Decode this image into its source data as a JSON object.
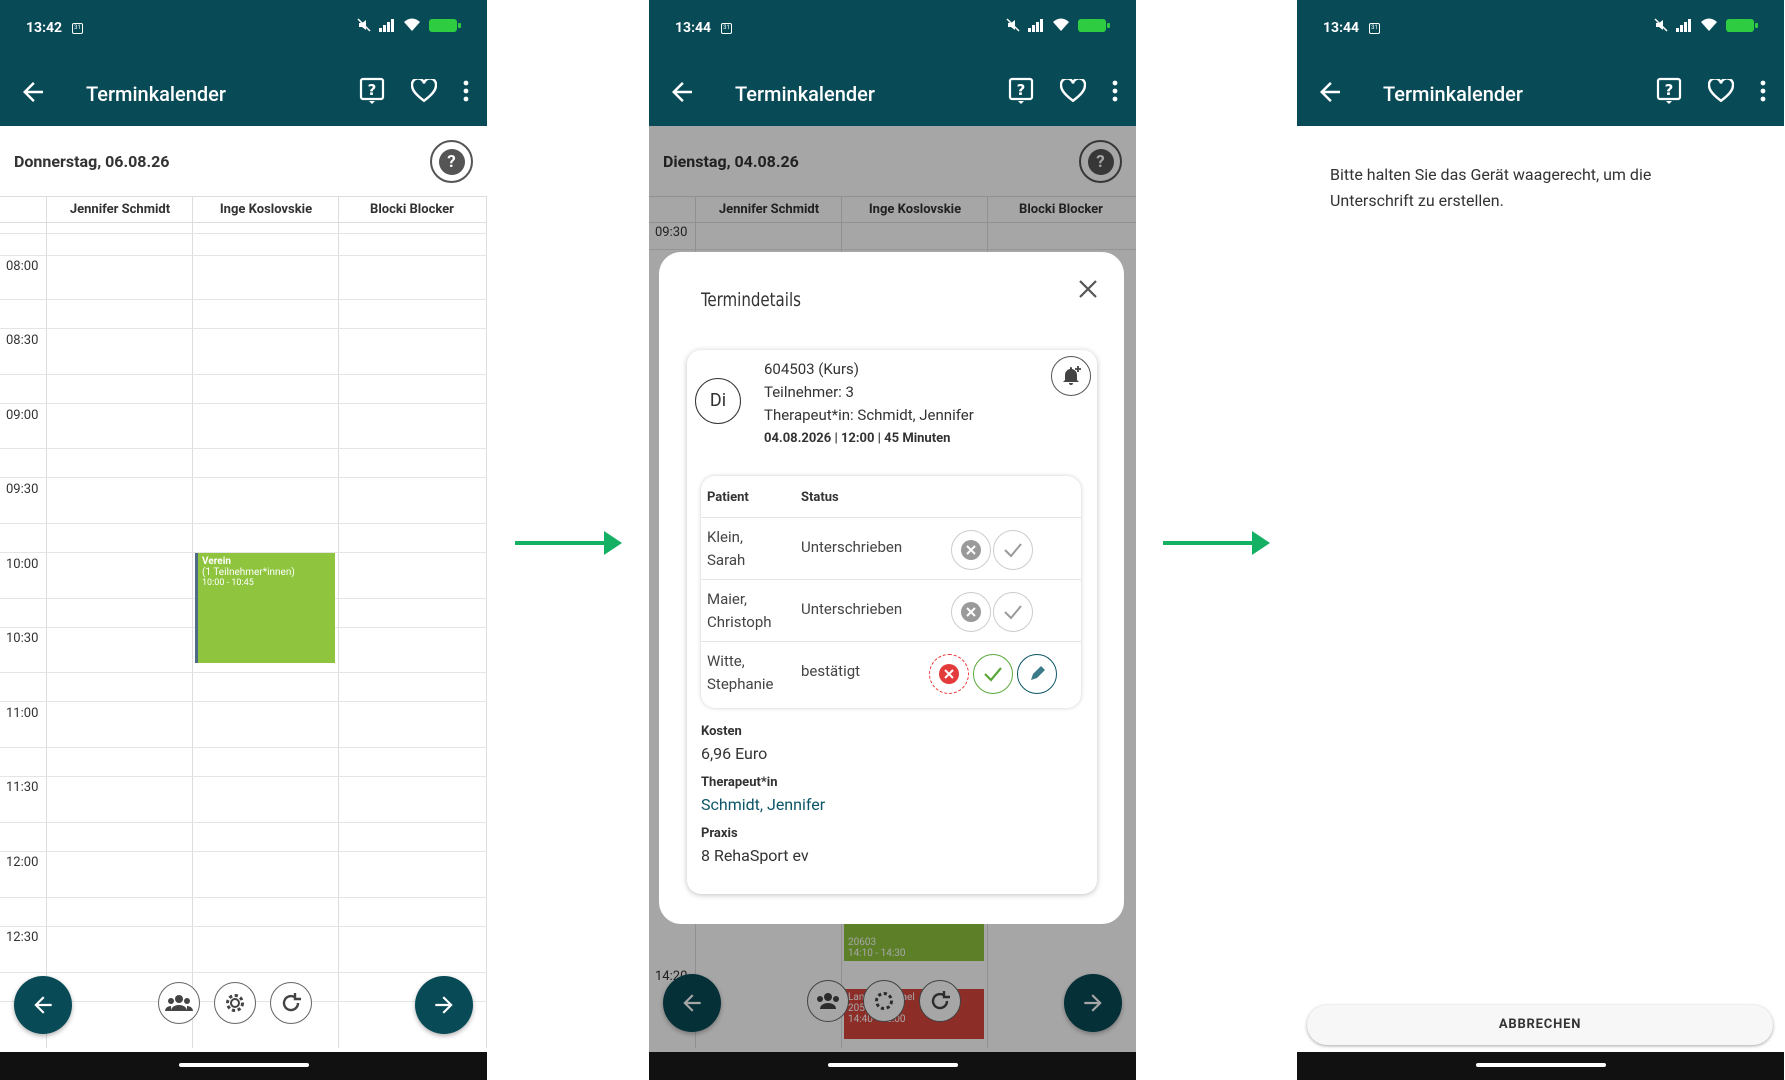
{
  "screen1": {
    "status_time": "13:42",
    "title": "Terminkalender",
    "date": "Donnerstag, 06.08.26",
    "columns": [
      "Jennifer Schmidt",
      "Inge Koslovskie",
      "Blocki Blocker"
    ],
    "times": [
      "08:00",
      "08:30",
      "09:00",
      "09:30",
      "10:00",
      "10:30",
      "11:00",
      "11:30",
      "12:00",
      "12:30"
    ],
    "event": {
      "title": "Verein",
      "subtitle": "(1 Teilnehmer*innen)",
      "time": "10:00 - 10:45",
      "color": "#8ec43e"
    }
  },
  "screen2": {
    "status_time": "13:44",
    "title": "Terminkalender",
    "date": "Dienstag, 04.08.26",
    "columns": [
      "Jennifer Schmidt",
      "Inge Koslovskie",
      "Blocki Blocker"
    ],
    "first_time": "09:30",
    "modal": {
      "title": "Termindetails",
      "day_badge": "Di",
      "line1": "604503 (Kurs)",
      "line2": "Teilnehmer: 3",
      "line3": "Therapeut*in: Schmidt, Jennifer",
      "line4": "04.08.2026 | 12:00 | 45 Minuten",
      "table_header_patient": "Patient",
      "table_header_status": "Status",
      "rows": [
        {
          "name_line1": "Klein,",
          "name_line2": "Sarah",
          "status": "Unterschrieben"
        },
        {
          "name_line1": "Maier,",
          "name_line2": "Christoph",
          "status": "Unterschrieben"
        },
        {
          "name_line1": "Witte,",
          "name_line2": "Stephanie",
          "status": "bestätigt"
        }
      ],
      "kosten_label": "Kosten",
      "kosten_value": "6,96 Euro",
      "therapeut_label": "Therapeut*in",
      "therapeut_value": "Schmidt, Jennifer",
      "praxis_label": "Praxis",
      "praxis_value": "8 RehaSport ev"
    },
    "bg_event1": {
      "name": "Lange, Michael",
      "id": "20501",
      "time": "14:40 - 15:00"
    },
    "bg_event2": {
      "id": "20603",
      "time": "14:10 - 14:30"
    },
    "bg_time": "14:20"
  },
  "screen3": {
    "status_time": "13:44",
    "title": "Terminkalender",
    "message": "Bitte halten Sie das Gerät waagerecht, um die Unterschrift zu erstellen.",
    "cancel_label": "ABBRECHEN"
  },
  "colors": {
    "primary": "#084b57",
    "accent": "#14b064",
    "event_green": "#8ec43e",
    "event_red": "#d9463e"
  }
}
